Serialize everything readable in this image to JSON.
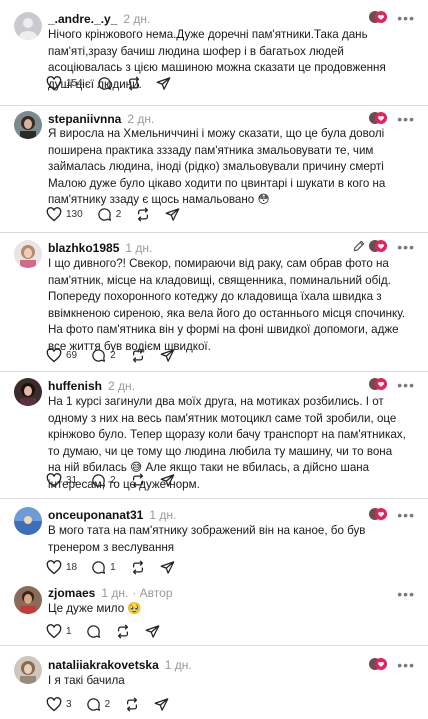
{
  "comments": [
    {
      "username": "_.andre._.y_",
      "age": "2 дн.",
      "text": "Нічого крінжового нема.Дуже доречні пам'ятники.Така дань пам'яті,зразу бачиш людина шофер і в багатьох людей асоціювалась з цією машиною можна сказати це продовження душі цієї людини.",
      "likes": "154",
      "replies": ""
    },
    {
      "username": "stepaniivnna",
      "age": "2 дн.",
      "text": "Я виросла на Хмельниччині і можу сказати, що це була доволі поширена практика зззаду пам'ятника змальовувати те, чим займалась людина, іноді (рідко) змальовували причину смерті\nМалою дуже було цікаво ходити по цвинтарі і шукати в кого на пам'ятнику ззаду є щось намальовано 😳",
      "likes": "130",
      "replies": "2"
    },
    {
      "username": "blazhko1985",
      "age": "1 дн.",
      "text": "І що дивного?! Свекор, помираючи від раку, сам обрав фото на пам'ятник, місце на кладовищі, священника, поминальний обід.\nПопереду похоронного котеджу до кладовища їхала швидка з ввімкненою сиреною, яка вела його до останнього місця спочинку.\nНа фото пам'ятника він у формі на фоні швидкої допомоги, адже все життя був водієм швидкої.",
      "likes": "69",
      "replies": "2"
    },
    {
      "username": "huffenish",
      "age": "2 дн.",
      "text": "На 1 курсі загинули два моїх друга, на мотиках розбились. І от одному з них на весь пам'ятник мотоцикл саме той зробили, оце крінжово було. Тепер щоразу коли бачу транспорт на пам'ятниках, то думаю, чи це тому що людина любила ту машину, чи то вона на ній вбилась 😅 Але якщо таки не вбилась, а дійсно шана інтересам, то це дуже норм.",
      "likes": "31",
      "replies": "2"
    },
    {
      "username": "onceuponanat31",
      "age": "1 дн.",
      "text": "В мого тата на пам'ятнику зображений він на каное, бо був тренером з веслування",
      "likes": "18",
      "replies": "1"
    },
    {
      "username": "zjomaes",
      "age": "1 дн.",
      "author": "· Автор",
      "text": "Це дуже мило 🥹",
      "likes": "1",
      "replies": ""
    },
    {
      "username": "nataliiakrakovetska",
      "age": "1 дн.",
      "text": "І я такі бачила",
      "likes": "3",
      "replies": "2"
    }
  ],
  "more_label": "•••",
  "icons": {
    "like": "heart-icon",
    "reply": "speech-bubble-icon",
    "repost": "repost-arrows-icon",
    "share": "paper-plane-icon",
    "more": "ellipsis-icon",
    "edit": "pencil-icon",
    "reaction": "reaction-badge-icon"
  },
  "colors": {
    "reaction_red": "#e0245e",
    "muted": "#999999",
    "divider": "#dbdbdb"
  }
}
